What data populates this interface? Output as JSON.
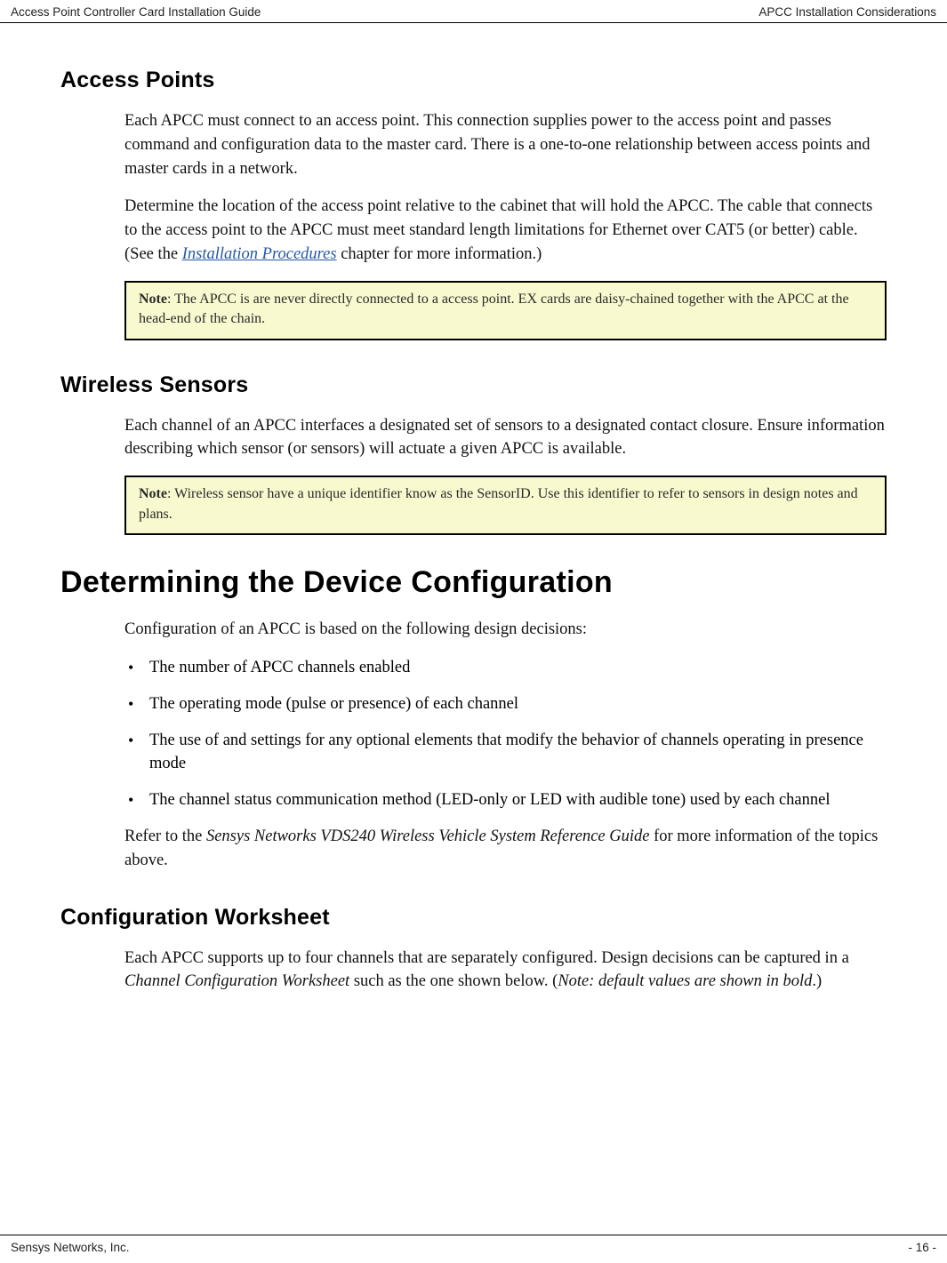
{
  "header": {
    "left": "Access Point Controller Card Installation Guide",
    "right": "APCC Installation Considerations"
  },
  "footer": {
    "left": "Sensys Networks, Inc.",
    "right": "- 16 -"
  },
  "sections": {
    "access_points": {
      "title": "Access Points",
      "p1": "Each APCC must connect to an access point. This connection supplies power to the access point and passes command and configuration data to the master card. There is a one-to-one relationship between access points and master cards in a network.",
      "p2a": "Determine the location of the access point relative to the cabinet that will hold the APCC. The cable that connects to the access point to the APCC must meet standard length limitations for Ethernet over CAT5 (or better) cable. (See the ",
      "p2_link": "Installation Procedures",
      "p2b": " chapter for more information.)",
      "note_label": "Note",
      "note_text": ": The APCC is are never directly connected to a access point. EX cards are daisy-chained together with the APCC at the head-end of the chain."
    },
    "wireless_sensors": {
      "title": "Wireless Sensors",
      "p1": "Each channel of an APCC interfaces a designated set of sensors to a designated contact closure. Ensure information describing which sensor (or sensors) will actuate a given APCC is available.",
      "note_label": "Note",
      "note_text": ": Wireless sensor have a unique identifier know as the SensorID. Use this identifier to refer to sensors in design notes and plans."
    },
    "determining": {
      "title": "Determining the Device Configuration",
      "p1": "Configuration of an APCC is based on the following design decisions:",
      "bullets": [
        "The number of APCC channels enabled",
        "The operating mode (pulse or presence) of each channel",
        "The use of and settings for any optional elements that modify the behavior of channels operating in presence mode",
        "The channel status communication method (LED-only or LED with audible tone) used by each channel"
      ],
      "p2a": "Refer to the ",
      "p2_ital": "Sensys Networks VDS240 Wireless Vehicle System Reference Guide",
      "p2b": " for more information of the topics above."
    },
    "config_worksheet": {
      "title": "Configuration Worksheet",
      "p1a": "Each APCC supports up to four channels that are separately configured. Design decisions can be captured in a ",
      "p1_ital1": "Channel Configuration Worksheet",
      "p1b": " such as the one shown below. (",
      "p1_ital2": "Note: default values are shown in bold",
      "p1c": ".)"
    }
  }
}
